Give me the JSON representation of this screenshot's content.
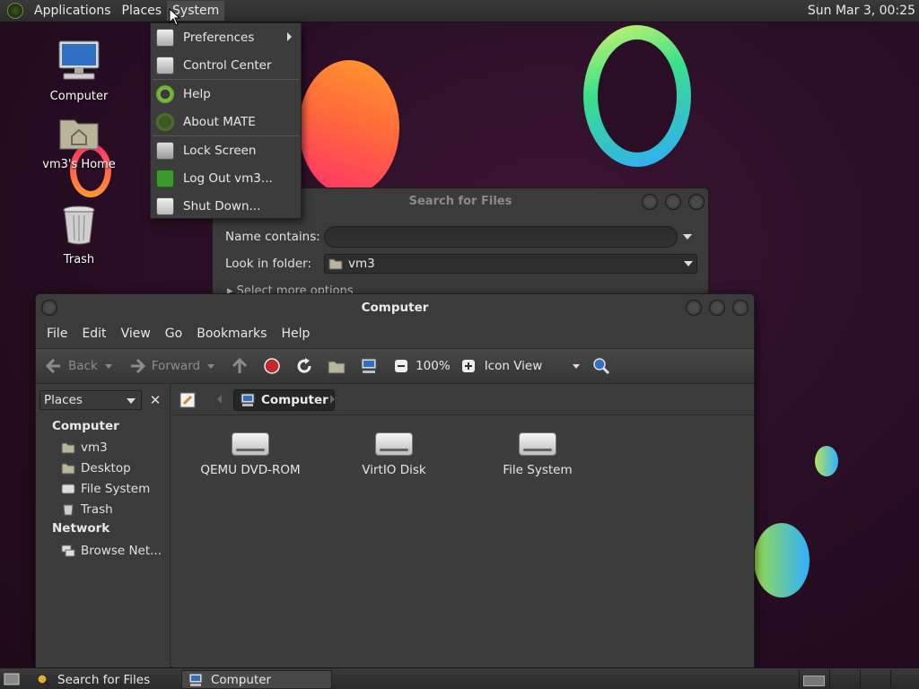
{
  "top_panel": {
    "menus": [
      "Applications",
      "Places",
      "System"
    ],
    "clock": "Sun Mar  3, 00:25"
  },
  "desktop_icons": [
    {
      "label": "Computer",
      "icon": "computer-icon"
    },
    {
      "label": "vm3's Home",
      "icon": "home-folder-icon"
    },
    {
      "label": "Trash",
      "icon": "trash-icon"
    }
  ],
  "system_menu": {
    "items": [
      {
        "label": "Preferences",
        "icon": "preferences-icon",
        "submenu": true
      },
      {
        "label": "Control Center",
        "icon": "control-center-icon"
      },
      {
        "label": "Help",
        "icon": "help-icon"
      },
      {
        "label": "About MATE",
        "icon": "about-mate-icon"
      },
      {
        "label": "Lock Screen",
        "icon": "lock-icon"
      },
      {
        "label": "Log Out vm3...",
        "icon": "logout-icon"
      },
      {
        "label": "Shut Down...",
        "icon": "shutdown-icon"
      }
    ]
  },
  "search_window": {
    "title": "Search for Files",
    "name_label": "Name contains:",
    "name_value": "",
    "folder_label": "Look in folder:",
    "folder_value": "vm3",
    "more_options": "Select more options"
  },
  "computer_window": {
    "title": "Computer",
    "menubar": [
      "File",
      "Edit",
      "View",
      "Go",
      "Bookmarks",
      "Help"
    ],
    "toolbar": {
      "back": "Back",
      "forward": "Forward",
      "zoom": "100%",
      "view_mode": "Icon View"
    },
    "sidebar": {
      "selector": "Places",
      "sections": [
        {
          "header": "Computer",
          "items": [
            "vm3",
            "Desktop",
            "File System",
            "Trash"
          ]
        },
        {
          "header": "Network",
          "items": [
            "Browse Net..."
          ]
        }
      ]
    },
    "location": "Computer",
    "files": [
      "QEMU DVD-ROM",
      "VirtIO Disk",
      "File System"
    ]
  },
  "bottom_panel": {
    "tasks": [
      "Search for Files",
      "Computer"
    ]
  },
  "colors": {
    "desktop_bg": "#2b0e26",
    "panel_bg": "#2c2c2c",
    "window_bg": "#3b3b3b"
  }
}
